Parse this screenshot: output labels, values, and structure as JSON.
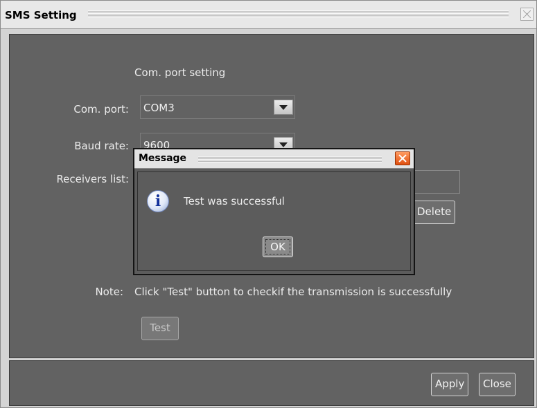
{
  "window": {
    "title": "SMS Setting"
  },
  "settings": {
    "section_title": "Com. port setting",
    "com_port_label": "Com. port:",
    "com_port_value": "COM3",
    "baud_rate_label": "Baud rate:",
    "baud_rate_value": "9600",
    "receivers_label": "Receivers list:",
    "delete_label": "Delete",
    "note_label": "Note:",
    "note_text": "Click \"Test\" button to checkif the transmission is successfully",
    "test_label": "Test"
  },
  "footer": {
    "apply_label": "Apply",
    "close_label": "Close"
  },
  "dialog": {
    "title": "Message",
    "info_glyph": "i",
    "message": "Test was successful",
    "ok_label": "OK"
  },
  "icons": [
    "close-icon",
    "dropdown-arrow-icon",
    "info-icon",
    "message-close-icon"
  ]
}
